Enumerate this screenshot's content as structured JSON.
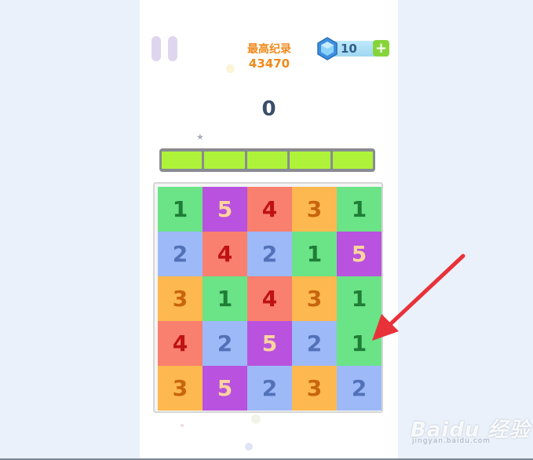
{
  "header": {
    "best_label": "最高纪录",
    "best_value": "43470",
    "gems": "10",
    "add_icon": "+"
  },
  "score": "0",
  "progress": {
    "segments": 5,
    "filled": 5
  },
  "board": {
    "rows": [
      [
        1,
        5,
        4,
        3,
        1
      ],
      [
        2,
        4,
        2,
        1,
        5
      ],
      [
        3,
        1,
        4,
        3,
        1
      ],
      [
        4,
        2,
        5,
        2,
        1
      ],
      [
        3,
        5,
        2,
        3,
        2
      ]
    ]
  },
  "colors": {
    "tile_1": "#6be387",
    "tile_2": "#9db9f8",
    "tile_3": "#fdb84f",
    "tile_4": "#f9806e",
    "tile_5": "#b952de",
    "best_text": "#f08a1c",
    "progress_fill": "#aef33a",
    "arrow": "#e8323a"
  },
  "icons": {
    "pause": "pause-icon",
    "gem": "gem-icon",
    "add": "plus-icon",
    "star": "star-icon"
  },
  "watermark": {
    "text": "Baidu 经验",
    "sub": "jingyan.baidu.com"
  }
}
